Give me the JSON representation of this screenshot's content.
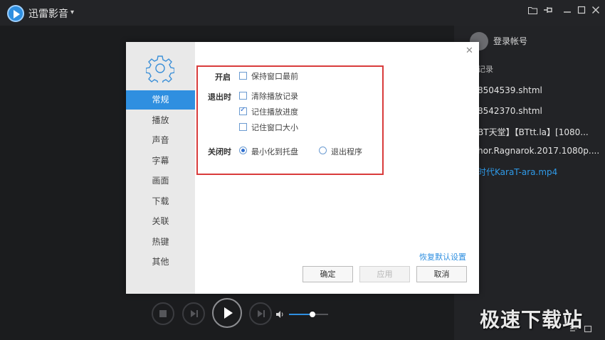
{
  "app": {
    "title": "迅雷影音"
  },
  "right_panel": {
    "login": "登录帐号",
    "history_label": "记录",
    "items": [
      {
        "label": "8504539.shtml",
        "active": false
      },
      {
        "label": "8542370.shtml",
        "active": false
      },
      {
        "label": "BT天堂】【BTtt.la】[1080...",
        "active": false
      },
      {
        "label": "hor.Ragnarok.2017.1080p....",
        "active": false
      },
      {
        "label": "时代KaraT-ara.mp4",
        "active": true
      }
    ]
  },
  "dialog": {
    "nav": [
      "常规",
      "播放",
      "声音",
      "字幕",
      "画面",
      "下载",
      "关联",
      "热键",
      "其他"
    ],
    "active_nav": 0,
    "sections": {
      "open_label": "开启",
      "open_option": "保持窗口最前",
      "exit_label": "退出时",
      "exit_options": [
        "清除播放记录",
        "记住播放进度",
        "记住窗口大小"
      ],
      "close_label": "关闭时",
      "close_options": [
        "最小化到托盘",
        "退出程序"
      ]
    },
    "states": {
      "keep_on_top": false,
      "exit_checks": [
        false,
        true,
        false
      ],
      "close_selected": 0
    },
    "restore_link": "恢复默认设置",
    "buttons": {
      "ok": "确定",
      "apply": "应用",
      "cancel": "取消"
    }
  },
  "player": {
    "volume_fraction": 0.6
  },
  "watermark": "极速下载站",
  "colors": {
    "accent": "#2f8fe0",
    "highlight_box": "#d93b3b"
  }
}
